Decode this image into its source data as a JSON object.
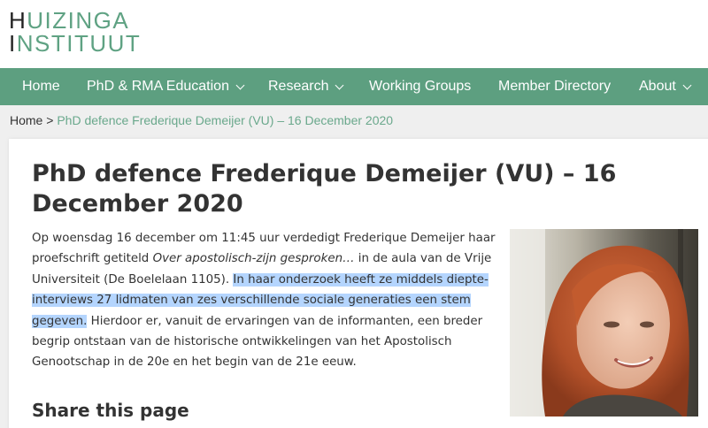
{
  "logo": {
    "line1": "UIZINGA",
    "line1_first": "H",
    "line2": "NSTITUUT",
    "line2_first": "I"
  },
  "nav": {
    "items": [
      {
        "label": "Home",
        "dropdown": false
      },
      {
        "label": "PhD & RMA Education",
        "dropdown": true
      },
      {
        "label": "Research",
        "dropdown": true
      },
      {
        "label": "Working Groups",
        "dropdown": false
      },
      {
        "label": "Member Directory",
        "dropdown": false
      },
      {
        "label": "About",
        "dropdown": true
      }
    ]
  },
  "breadcrumb": {
    "home": "Home",
    "separator": " > ",
    "current": "PhD defence Frederique Demeijer (VU) – 16 December 2020"
  },
  "article": {
    "title": "PhD defence Frederique Demeijer (VU) – 16 December 2020",
    "p1_before": "Op woensdag 16 december om 11:45 uur verdedigt Frederique Demeijer haar proefschrift getiteld ",
    "p1_italic": "Over apostolisch-zijn gesproken…",
    "p1_after": " in de aula van de Vrije Universiteit (De Boelelaan 1105). ",
    "p1_highlight": "In haar onderzoek heeft ze middels diepte-interviews 27 lidmaten van zes verschillende sociale generaties een stem gegeven.",
    "p1_end": " Hierdoor er, vanuit de ervaringen van de informanten, een breder begrip ontstaan van de historische ontwikkelingen van het Apostolisch Genootschap in de 20e en het begin van de 21e eeuw."
  },
  "share": {
    "heading": "Share this page"
  },
  "colors": {
    "brand_green": "#5d9f80",
    "link_green": "#6aa88c",
    "highlight": "#b4d5fe"
  }
}
